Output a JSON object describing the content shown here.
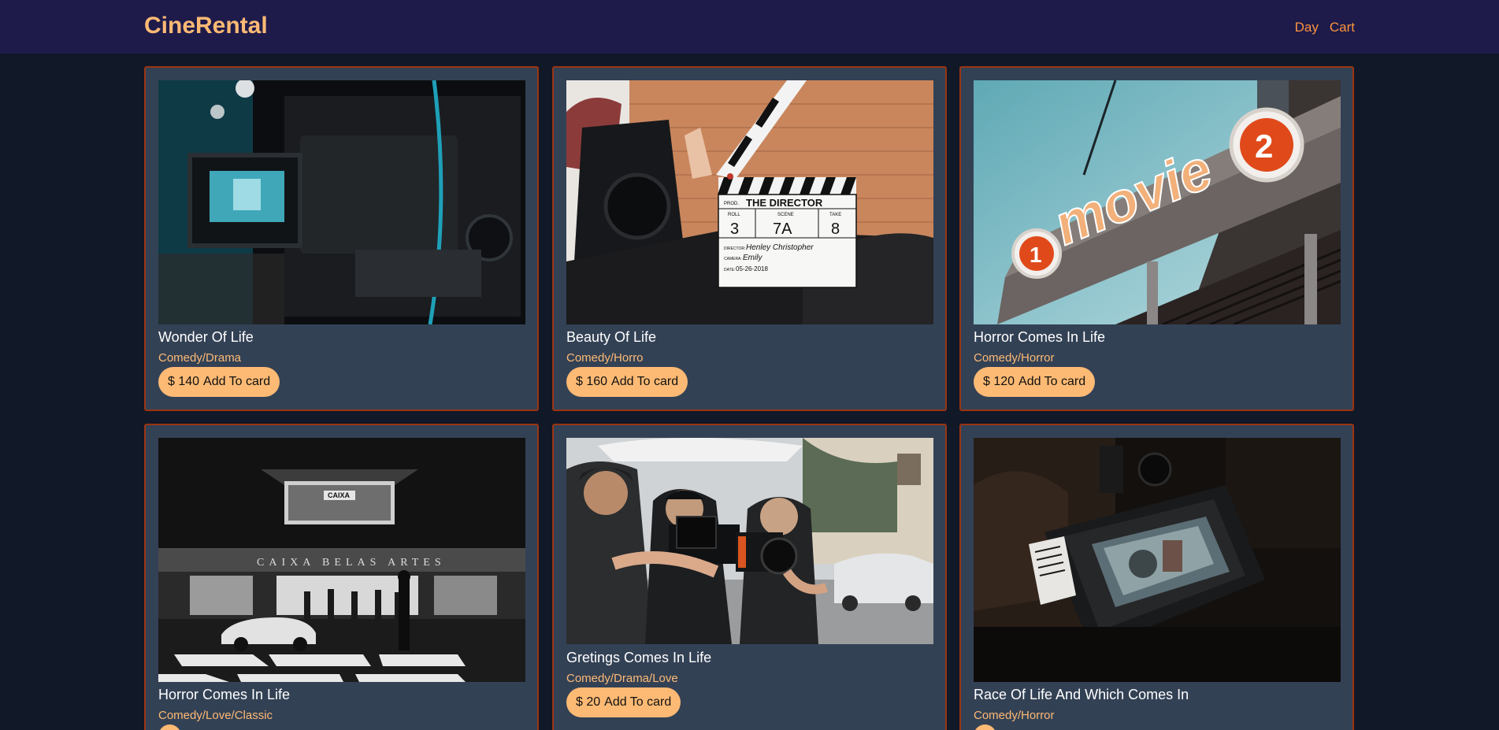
{
  "app": {
    "brand": "CineRental"
  },
  "nav": {
    "items": [
      {
        "label": "Day"
      },
      {
        "label": "Cart"
      }
    ]
  },
  "movies": [
    {
      "title": "Wonder Of Life",
      "genre": "Comedy/Drama",
      "price": "$ 140",
      "action": "Add To card",
      "image_icon": "camera-viewfinder-image"
    },
    {
      "title": "Beauty Of Life",
      "genre": "Comedy/Horro",
      "price": "$ 160",
      "action": "Add To card",
      "image_icon": "clapperboard-image",
      "clapper": {
        "prod": "PROD.",
        "heading": "THE DIRECTOR",
        "roll_label": "ROLL",
        "scene_label": "SCENE",
        "take_label": "TAKE",
        "roll": "3",
        "scene": "7A",
        "take": "8",
        "director": "Henley Christopher",
        "camera": "Emily",
        "date": "05-26-2018"
      }
    },
    {
      "title": "Horror Comes In Life",
      "genre": "Comedy/Horror",
      "price": "$ 120",
      "action": "Add To card",
      "image_icon": "movie-sign-image",
      "sign": {
        "left_number": "1",
        "word": "movie",
        "right_number": "2"
      }
    },
    {
      "title": "Horror Comes In Life",
      "genre": "Comedy/Love/Classic",
      "price": "",
      "action": "",
      "image_icon": "cinema-facade-image",
      "facade": {
        "marquee": "CAIXA",
        "name": "CAIXA BELAS ARTES"
      }
    },
    {
      "title": "Gretings Comes In Life",
      "genre": "Comedy/Drama/Love",
      "price": "$ 20",
      "action": "Add To card",
      "image_icon": "film-crew-image"
    },
    {
      "title": "Race Of Life And Which Comes In",
      "genre": "Comedy/Horror",
      "price": "",
      "action": "",
      "image_icon": "camera-monitor-image"
    }
  ]
}
